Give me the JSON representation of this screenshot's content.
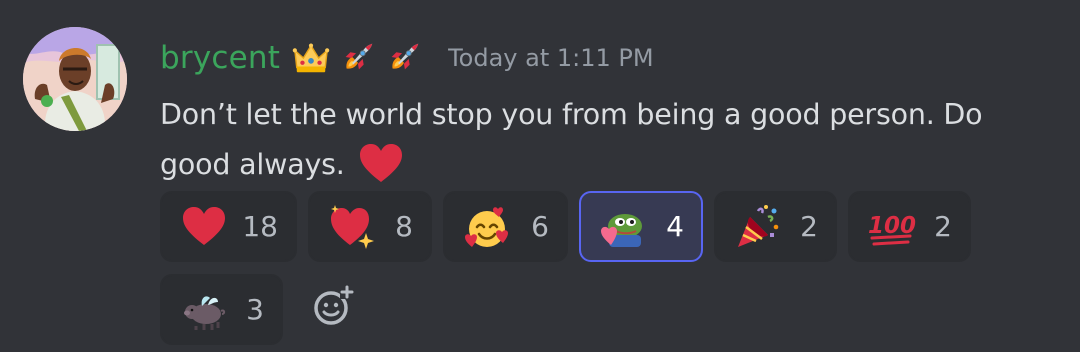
{
  "message": {
    "author": "brycent",
    "author_color": "#3ba55c",
    "badges": [
      "crown-emoji",
      "rocket-emoji",
      "rocket-emoji"
    ],
    "timestamp": "Today at 1:11 PM",
    "text": "Don’t let the world stop you from being a good person. Do good always.",
    "trailing_emoji": "red-heart-emoji"
  },
  "reactions": [
    {
      "emoji": "red-heart",
      "count": "18",
      "active": false
    },
    {
      "emoji": "sparkling-heart",
      "count": "8",
      "active": false
    },
    {
      "emoji": "smiling-face-with-hearts",
      "count": "6",
      "active": false
    },
    {
      "emoji": "peepo-hug-heart",
      "count": "4",
      "active": true
    },
    {
      "emoji": "party-popper",
      "count": "2",
      "active": false
    },
    {
      "emoji": "hundred-points",
      "count": "2",
      "active": false
    },
    {
      "emoji": "flying-pig",
      "count": "3",
      "active": false
    }
  ],
  "colors": {
    "background": "#313338",
    "reaction_background": "#2b2d31",
    "active_reaction_border": "#5865f2",
    "timestamp": "#949ba4",
    "text": "#dbdee1"
  }
}
